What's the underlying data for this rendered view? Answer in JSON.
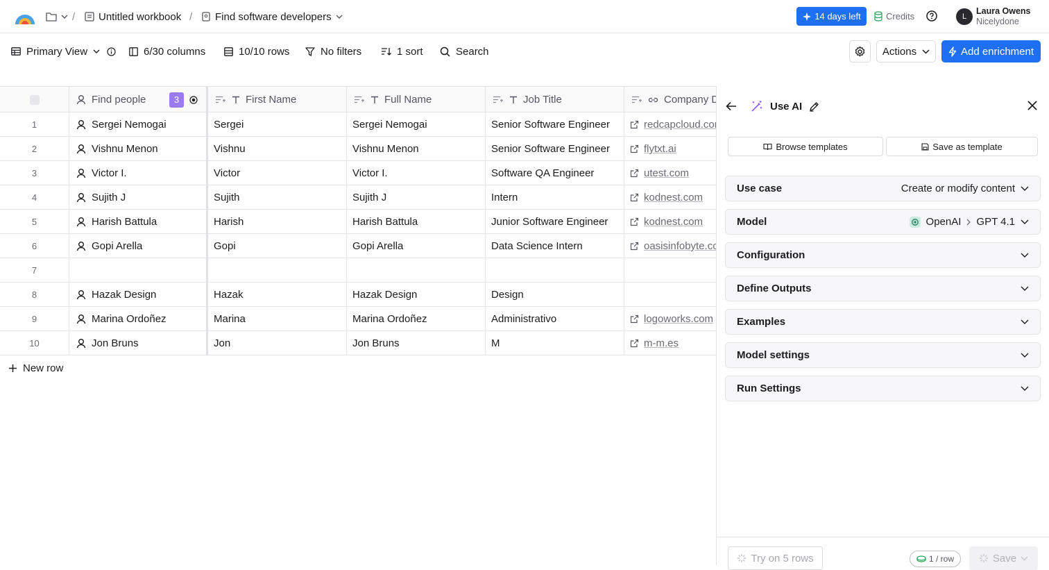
{
  "header": {
    "workbook": "Untitled workbook",
    "table": "Find software developers",
    "trial": "14 days left",
    "credits": "Credits",
    "user": {
      "initial": "L",
      "name": "Laura Owens",
      "org": "Nicelydone"
    }
  },
  "toolbar": {
    "view": "Primary View",
    "columns": "6/30 columns",
    "rows": "10/10 rows",
    "filters": "No filters",
    "sort": "1 sort",
    "search": "Search",
    "actions": "Actions",
    "add_enrichment": "Add enrichment"
  },
  "table": {
    "headers": [
      "Find people",
      "First Name",
      "Full Name",
      "Job Title",
      "Company Do"
    ],
    "find_people_badge": "3",
    "rows": [
      {
        "n": "1",
        "person": "Sergei Nemogai",
        "first": "Sergei",
        "full": "Sergei Nemogai",
        "job": "Senior Software Engineer",
        "domain": "redcapcloud.com"
      },
      {
        "n": "2",
        "person": "Vishnu Menon",
        "first": "Vishnu",
        "full": "Vishnu Menon",
        "job": "Senior Software Engineer",
        "domain": "flytxt.ai"
      },
      {
        "n": "3",
        "person": "Victor I.",
        "first": "Victor",
        "full": "Victor I.",
        "job": "Software QA Engineer",
        "domain": "utest.com"
      },
      {
        "n": "4",
        "person": "Sujith J",
        "first": "Sujith",
        "full": "Sujith J",
        "job": "Intern",
        "domain": "kodnest.com"
      },
      {
        "n": "5",
        "person": "Harish Battula",
        "first": "Harish",
        "full": "Harish Battula",
        "job": "Junior Software Engineer",
        "domain": "kodnest.com"
      },
      {
        "n": "6",
        "person": "Gopi Arella",
        "first": "Gopi",
        "full": "Gopi Arella",
        "job": "Data Science Intern",
        "domain": "oasisinfobyte.com"
      },
      {
        "n": "7",
        "person": "",
        "first": "",
        "full": "",
        "job": "",
        "domain": ""
      },
      {
        "n": "8",
        "person": "Hazak Design",
        "first": "Hazak",
        "full": "Hazak Design",
        "job": "Design",
        "domain": ""
      },
      {
        "n": "9",
        "person": "Marina Ordoñez",
        "first": "Marina",
        "full": "Marina Ordoñez",
        "job": "Administrativo",
        "domain": "logoworks.com"
      },
      {
        "n": "10",
        "person": "Jon Bruns",
        "first": "Jon",
        "full": "Jon Bruns",
        "job": "M",
        "domain": "m-m.es"
      }
    ],
    "new_row": "New row"
  },
  "panel": {
    "title": "Use AI",
    "browse_templates": "Browse templates",
    "save_template": "Save as template",
    "use_case_label": "Use case",
    "use_case_value": "Create or modify content",
    "model_label": "Model",
    "model_provider": "OpenAI",
    "model_name": "GPT 4.1",
    "sections": [
      "Configuration",
      "Define Outputs",
      "Examples",
      "Model settings",
      "Run Settings"
    ],
    "try_rows": "Try on 5 rows",
    "per_row": "1 / row",
    "save": "Save"
  },
  "colors": {
    "accent": "#1f6ff2",
    "badge": "#9b7cf0",
    "panel_icon": "#8b5cf6"
  }
}
